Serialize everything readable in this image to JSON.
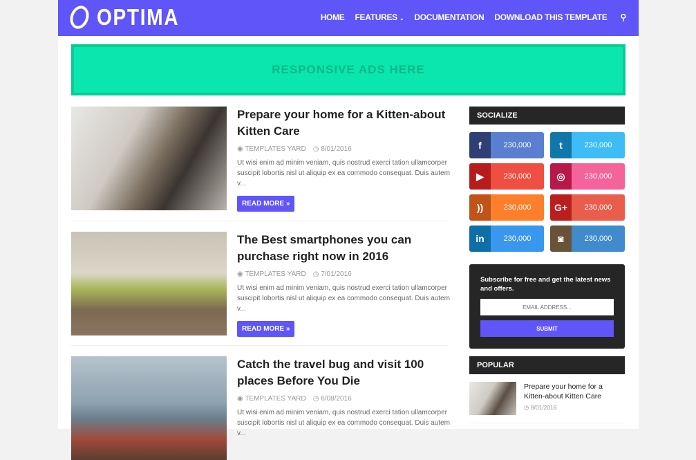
{
  "header": {
    "logo": "OPTIMA",
    "nav": [
      "HOME",
      "FEATURES",
      "DOCUMENTATION",
      "DOWNLOAD THIS TEMPLATE"
    ],
    "search_icon": "search-icon"
  },
  "ad": {
    "text": "RESPONSIVE ADS HERE"
  },
  "posts": [
    {
      "title": "Prepare your home for a Kitten-about Kitten Care",
      "author": "TEMPLATES YARD",
      "date": "8/01/2016",
      "excerpt": "Ut wisi enim ad minim veniam, quis nostrud exerci tation ullamcorper suscipit lobortis nisl ut aliquip ex ea commodo consequat. Duis autem v...",
      "button": "READ MORE »"
    },
    {
      "title": "The Best smartphones you can purchase right now in 2016",
      "author": "TEMPLATES YARD",
      "date": "7/01/2016",
      "excerpt": "Ut wisi enim ad minim veniam, quis nostrud exerci tation ullamcorper suscipit lobortis nisl ut aliquip ex ea commodo consequat. Duis autem v...",
      "button": "READ MORE »"
    },
    {
      "title": "Catch the travel bug and visit 100 places Before You Die",
      "author": "TEMPLATES YARD",
      "date": "6/08/2016",
      "excerpt": "Ut wisi enim ad minim veniam, quis nostrud exerci tation ullamcorper suscipit lobortis nisl ut aliquip ex ea commodo consequat. Duis autem v..."
    }
  ],
  "sidebar": {
    "socialize_title": "SOCIALIZE",
    "social": [
      {
        "icon": "facebook-icon",
        "glyph": "f",
        "count": "230,000",
        "dark": "#2f3e73",
        "light": "#5a7fd1"
      },
      {
        "icon": "twitter-icon",
        "glyph": "t",
        "count": "230,000",
        "dark": "#1177aa",
        "light": "#3ebcf5"
      },
      {
        "icon": "youtube-icon",
        "glyph": "▶",
        "count": "230,000",
        "dark": "#b71c1c",
        "light": "#ef4e43"
      },
      {
        "icon": "dribbble-icon",
        "glyph": "◎",
        "count": "230,000",
        "dark": "#b71849",
        "light": "#f4639a"
      },
      {
        "icon": "rss-icon",
        "glyph": "))",
        "count": "230,000",
        "dark": "#c0531a",
        "light": "#fd7f2c"
      },
      {
        "icon": "google-plus-icon",
        "glyph": "G+",
        "count": "230,000",
        "dark": "#bb1e1e",
        "light": "#e95d4c"
      },
      {
        "icon": "linkedin-icon",
        "glyph": "in",
        "count": "230,000",
        "dark": "#0e6fa8",
        "light": "#3a97ee"
      },
      {
        "icon": "instagram-icon",
        "glyph": "◙",
        "count": "230,000",
        "dark": "#6a523a",
        "light": "#3f8bcd"
      }
    ],
    "subscribe": {
      "text": "Subscribe for free and get the latest news and offers.",
      "placeholder": "EMAIL ADDRESS...",
      "button": "SUBMIT"
    },
    "popular_title": "POPULAR",
    "popular": [
      {
        "title": "Prepare your home for a Kitten-about Kitten Care",
        "date": "8/01/2016"
      }
    ]
  }
}
